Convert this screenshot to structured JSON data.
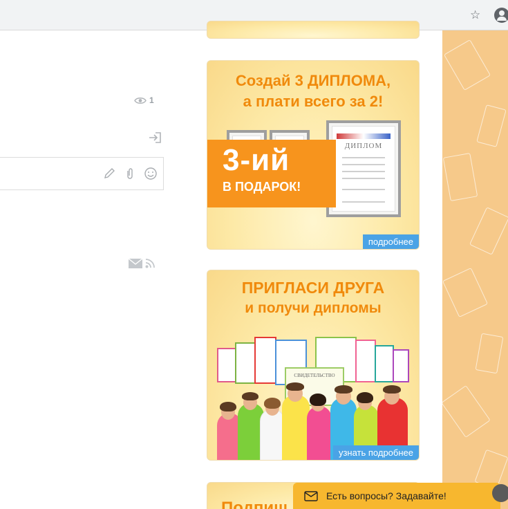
{
  "browser": {
    "star_icon": "star-icon",
    "account_icon": "account-icon"
  },
  "post": {
    "view_count": "1",
    "icons": [
      "eye-icon",
      "login-icon",
      "pencil-icon",
      "paperclip-icon",
      "smiley-icon",
      "mail-icon",
      "rss-icon"
    ]
  },
  "ads": {
    "ad1": {
      "title_line1": "Создай 3 ДИПЛОМА,",
      "title_line2": "а плати всего за 2!",
      "cert_heading": "ДИПЛОМ",
      "promo_big": "3-ий",
      "promo_small": "В ПОДАРОК!",
      "link": "подробнее"
    },
    "ad2": {
      "title_line1": "ПРИГЛАСИ ДРУГА",
      "title_line2": "и получи дипломы",
      "cert_heading": "СВИДЕТЕЛЬСТВО",
      "link": "узнать подробнее"
    },
    "ad3": {
      "title_partial": "Подпиш"
    }
  },
  "chat": {
    "label": "Есть вопросы? Задавайте!",
    "icon": "chat-bubble-icon"
  },
  "colors": {
    "accent_orange": "#f08a0c",
    "promo_orange": "#f7941d",
    "link_blue": "#4aa3e6",
    "chat_yellow": "#f7b72f",
    "side_bg": "#f6c98a"
  }
}
